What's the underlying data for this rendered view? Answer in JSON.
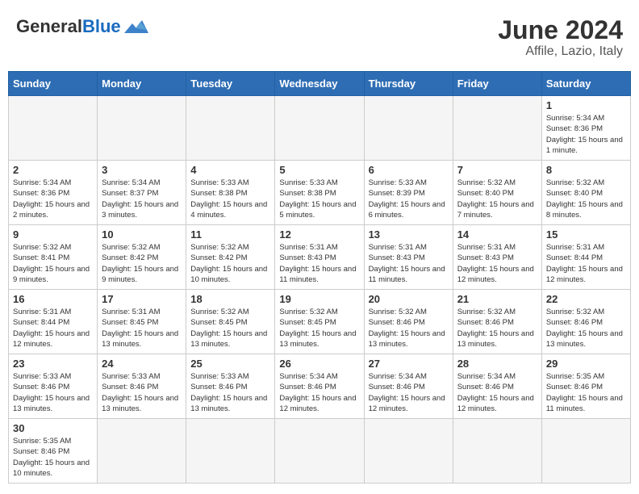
{
  "header": {
    "logo_general": "General",
    "logo_blue": "Blue",
    "month_year": "June 2024",
    "location": "Affile, Lazio, Italy"
  },
  "days_of_week": [
    "Sunday",
    "Monday",
    "Tuesday",
    "Wednesday",
    "Thursday",
    "Friday",
    "Saturday"
  ],
  "weeks": [
    [
      {
        "day": "",
        "info": ""
      },
      {
        "day": "",
        "info": ""
      },
      {
        "day": "",
        "info": ""
      },
      {
        "day": "",
        "info": ""
      },
      {
        "day": "",
        "info": ""
      },
      {
        "day": "",
        "info": ""
      },
      {
        "day": "1",
        "info": "Sunrise: 5:34 AM\nSunset: 8:36 PM\nDaylight: 15 hours\nand 1 minute."
      }
    ],
    [
      {
        "day": "2",
        "info": "Sunrise: 5:34 AM\nSunset: 8:36 PM\nDaylight: 15 hours\nand 2 minutes."
      },
      {
        "day": "3",
        "info": "Sunrise: 5:34 AM\nSunset: 8:37 PM\nDaylight: 15 hours\nand 3 minutes."
      },
      {
        "day": "4",
        "info": "Sunrise: 5:33 AM\nSunset: 8:38 PM\nDaylight: 15 hours\nand 4 minutes."
      },
      {
        "day": "5",
        "info": "Sunrise: 5:33 AM\nSunset: 8:38 PM\nDaylight: 15 hours\nand 5 minutes."
      },
      {
        "day": "6",
        "info": "Sunrise: 5:33 AM\nSunset: 8:39 PM\nDaylight: 15 hours\nand 6 minutes."
      },
      {
        "day": "7",
        "info": "Sunrise: 5:32 AM\nSunset: 8:40 PM\nDaylight: 15 hours\nand 7 minutes."
      },
      {
        "day": "8",
        "info": "Sunrise: 5:32 AM\nSunset: 8:40 PM\nDaylight: 15 hours\nand 8 minutes."
      }
    ],
    [
      {
        "day": "9",
        "info": "Sunrise: 5:32 AM\nSunset: 8:41 PM\nDaylight: 15 hours\nand 9 minutes."
      },
      {
        "day": "10",
        "info": "Sunrise: 5:32 AM\nSunset: 8:42 PM\nDaylight: 15 hours\nand 9 minutes."
      },
      {
        "day": "11",
        "info": "Sunrise: 5:32 AM\nSunset: 8:42 PM\nDaylight: 15 hours\nand 10 minutes."
      },
      {
        "day": "12",
        "info": "Sunrise: 5:31 AM\nSunset: 8:43 PM\nDaylight: 15 hours\nand 11 minutes."
      },
      {
        "day": "13",
        "info": "Sunrise: 5:31 AM\nSunset: 8:43 PM\nDaylight: 15 hours\nand 11 minutes."
      },
      {
        "day": "14",
        "info": "Sunrise: 5:31 AM\nSunset: 8:43 PM\nDaylight: 15 hours\nand 12 minutes."
      },
      {
        "day": "15",
        "info": "Sunrise: 5:31 AM\nSunset: 8:44 PM\nDaylight: 15 hours\nand 12 minutes."
      }
    ],
    [
      {
        "day": "16",
        "info": "Sunrise: 5:31 AM\nSunset: 8:44 PM\nDaylight: 15 hours\nand 12 minutes."
      },
      {
        "day": "17",
        "info": "Sunrise: 5:31 AM\nSunset: 8:45 PM\nDaylight: 15 hours\nand 13 minutes."
      },
      {
        "day": "18",
        "info": "Sunrise: 5:32 AM\nSunset: 8:45 PM\nDaylight: 15 hours\nand 13 minutes."
      },
      {
        "day": "19",
        "info": "Sunrise: 5:32 AM\nSunset: 8:45 PM\nDaylight: 15 hours\nand 13 minutes."
      },
      {
        "day": "20",
        "info": "Sunrise: 5:32 AM\nSunset: 8:46 PM\nDaylight: 15 hours\nand 13 minutes."
      },
      {
        "day": "21",
        "info": "Sunrise: 5:32 AM\nSunset: 8:46 PM\nDaylight: 15 hours\nand 13 minutes."
      },
      {
        "day": "22",
        "info": "Sunrise: 5:32 AM\nSunset: 8:46 PM\nDaylight: 15 hours\nand 13 minutes."
      }
    ],
    [
      {
        "day": "23",
        "info": "Sunrise: 5:33 AM\nSunset: 8:46 PM\nDaylight: 15 hours\nand 13 minutes."
      },
      {
        "day": "24",
        "info": "Sunrise: 5:33 AM\nSunset: 8:46 PM\nDaylight: 15 hours\nand 13 minutes."
      },
      {
        "day": "25",
        "info": "Sunrise: 5:33 AM\nSunset: 8:46 PM\nDaylight: 15 hours\nand 13 minutes."
      },
      {
        "day": "26",
        "info": "Sunrise: 5:34 AM\nSunset: 8:46 PM\nDaylight: 15 hours\nand 12 minutes."
      },
      {
        "day": "27",
        "info": "Sunrise: 5:34 AM\nSunset: 8:46 PM\nDaylight: 15 hours\nand 12 minutes."
      },
      {
        "day": "28",
        "info": "Sunrise: 5:34 AM\nSunset: 8:46 PM\nDaylight: 15 hours\nand 12 minutes."
      },
      {
        "day": "29",
        "info": "Sunrise: 5:35 AM\nSunset: 8:46 PM\nDaylight: 15 hours\nand 11 minutes."
      }
    ],
    [
      {
        "day": "30",
        "info": "Sunrise: 5:35 AM\nSunset: 8:46 PM\nDaylight: 15 hours\nand 10 minutes."
      },
      {
        "day": "",
        "info": ""
      },
      {
        "day": "",
        "info": ""
      },
      {
        "day": "",
        "info": ""
      },
      {
        "day": "",
        "info": ""
      },
      {
        "day": "",
        "info": ""
      },
      {
        "day": "",
        "info": ""
      }
    ]
  ]
}
